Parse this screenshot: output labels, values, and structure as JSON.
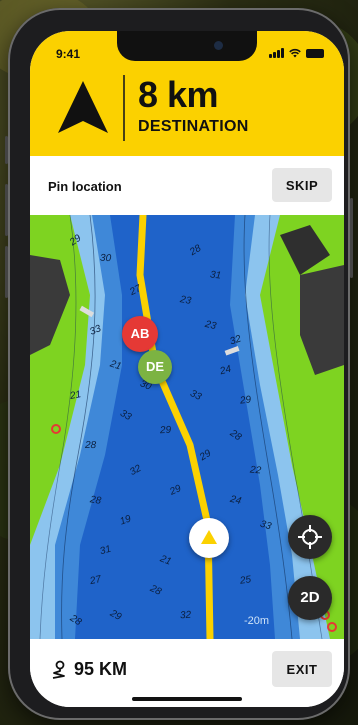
{
  "status": {
    "time": "9:41"
  },
  "navigation": {
    "distance": "8 km",
    "distance_caption": "DESTINATION",
    "direction_icon": "navigation-arrow-icon"
  },
  "pin_bar": {
    "label": "Pin location",
    "skip_label": "SKIP"
  },
  "map": {
    "waypoints": [
      {
        "label": "AB",
        "color": "#e53935"
      },
      {
        "label": "DE",
        "color": "#7cb342"
      }
    ],
    "buttons": {
      "recenter_icon": "crosshair-icon",
      "view_mode_label": "2D"
    },
    "depth_contour_label": "-20m",
    "depth_soundings": [
      "29",
      "30",
      "28",
      "31",
      "27",
      "23",
      "33",
      "23",
      "32",
      "21",
      "24",
      "30",
      "21",
      "33",
      "29",
      "33",
      "29",
      "28",
      "28",
      "29",
      "22",
      "32",
      "28",
      "29",
      "24",
      "19",
      "33",
      "31",
      "21",
      "27",
      "28",
      "25",
      "29",
      "32",
      "28"
    ],
    "colors": {
      "deep_water": "#1f63c9",
      "mid_water": "#3f88d8",
      "shallow_water": "#8cc4ee",
      "land": "#7ed321",
      "route": "#fbd100"
    }
  },
  "bottom_bar": {
    "route_distance": "95 KM",
    "exit_label": "EXIT"
  },
  "theme": {
    "accent": "#fbd100"
  }
}
